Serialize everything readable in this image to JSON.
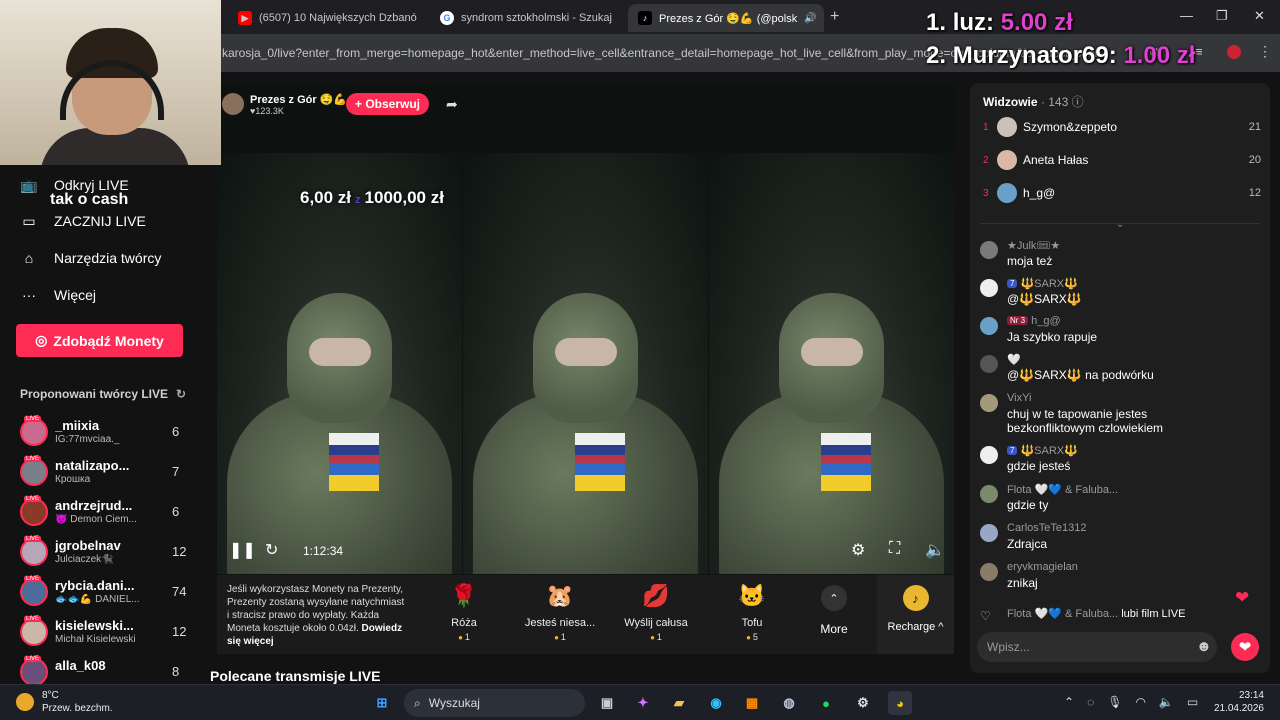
{
  "browser": {
    "tabs": [
      {
        "title": "(6507) 10 Największych Dzbanó",
        "icon": "youtube-icon"
      },
      {
        "title": "syndrom sztokholmski - Szukaj",
        "icon": "google-icon"
      },
      {
        "title": "Prezes z Gór 🤤💪 (@polsk",
        "icon": "tiktok-icon"
      }
    ],
    "url": "karosja_0/live?enter_from_merge=homepage_hot&enter_method=live_cell&entrance_detail=homepage_hot_live_cell&from_play_mode=one_column&is_guest_connect"
  },
  "overlay": {
    "lines": [
      {
        "rank": "1.",
        "name": "luz:",
        "amount": "5.00 zł"
      },
      {
        "rank": "2.",
        "name": "Murzynator69:",
        "amount": "1.00 zł"
      }
    ]
  },
  "colors": {
    "accent": "#fe2c55",
    "overlay_amount": "#e040d0",
    "coin": "#e9b730"
  },
  "nav": {
    "tak_o_cash": "tak o cash",
    "items": [
      {
        "label": "Odkryj LIVE",
        "icon": "tv-icon"
      },
      {
        "label": "ZACZNIJ LIVE",
        "icon": "camera-icon"
      },
      {
        "label": "Narzędzia twórcy",
        "icon": "lightbulb-icon"
      },
      {
        "label": "Więcej",
        "icon": "more-dots-icon"
      }
    ],
    "coins_button": "Zdobądź Monety",
    "suggested_title": "Proponowani twórcy LIVE",
    "creators": [
      {
        "name": "_miixia",
        "sub": "IG:77mvciaa._",
        "count": "6"
      },
      {
        "name": "natalizapo...",
        "sub": "Крошка",
        "count": "7"
      },
      {
        "name": "andrzejrud...",
        "sub": "👿 Demon Ciem...",
        "count": "6"
      },
      {
        "name": "jgrobelnav",
        "sub": "Julciaczek🐈‍⬛",
        "count": "12"
      },
      {
        "name": "rybcia.dani...",
        "sub": "🐟🐟💪 DANIEL...",
        "count": "74"
      },
      {
        "name": "kisielewski...",
        "sub": "Michał Kisielewski",
        "count": "12"
      },
      {
        "name": "alla_k08",
        "sub": "",
        "count": "8"
      }
    ]
  },
  "stream": {
    "name": "Prezes z Gór 🤤💪",
    "likes": "♥123.3K",
    "follow": "+ Obserwuj",
    "goal_current": "6,00 zł",
    "goal_sep": "z",
    "goal_target": "1000,00 zł",
    "time": "1:12:34"
  },
  "gifts": {
    "info": "Jeśli wykorzystasz Monety na Prezenty, Prezenty zostaną wysyłane natychmiast i stracisz prawo do wypłaty. Każda Moneta kosztuje około 0.04zł.",
    "info_link": "Dowiedz się więcej",
    "items": [
      {
        "name": "Róża",
        "price": "1",
        "icon": "🌹"
      },
      {
        "name": "Jesteś niesa...",
        "price": "1",
        "icon": "🐹"
      },
      {
        "name": "Wyślij całusa",
        "price": "1",
        "icon": "💋"
      },
      {
        "name": "Tofu",
        "price": "5",
        "icon": "🐱"
      }
    ],
    "more": "More",
    "recharge": "Recharge ^"
  },
  "below_title": "Polecane transmisje LIVE",
  "chat": {
    "viewers_label": "Widzowie",
    "viewers_count": "· 143",
    "top": [
      {
        "rank": "1",
        "name": "Szymon&zeppeto",
        "score": "21"
      },
      {
        "rank": "2",
        "name": "Aneta Hałas",
        "score": "20"
      },
      {
        "rank": "3",
        "name": "h_g@",
        "score": "12"
      }
    ],
    "messages": [
      {
        "user": "★Julk🎟★",
        "badge": "",
        "text": "moja też"
      },
      {
        "user": "🔱SARX🔱",
        "badge": "7",
        "text": "@🔱SARX🔱"
      },
      {
        "user": "h_g@",
        "badge": "Nr 3",
        "text": "Ja szybko rapuje"
      },
      {
        "user": "🤍",
        "badge": "",
        "text": "@🔱SARX🔱 na podwórku"
      },
      {
        "user": "VixYi",
        "badge": "",
        "text": "chuj w te tapowanie jestes bezkonfliktowym czlowiekiem"
      },
      {
        "user": "🔱SARX🔱",
        "badge": "7",
        "text": "gdzie jesteś"
      },
      {
        "user": "Flota 🤍💙 & Faluba...",
        "badge": "",
        "text": "gdzie ty"
      },
      {
        "user": "CarlosTeTe1312",
        "badge": "",
        "text": "Zdrajca"
      },
      {
        "user": "eryvkmagielan",
        "badge": "",
        "text": "znikaj"
      }
    ],
    "join_user": "Flota 🤍💙 & Faluba...",
    "join_text": "lubi film LIVE",
    "input_placeholder": "Wpisz..."
  },
  "taskbar": {
    "temp": "8°C",
    "weather": "Przew. bezchm.",
    "search": "Wyszukaj",
    "time": "23:14",
    "date": "21.04.2026"
  }
}
